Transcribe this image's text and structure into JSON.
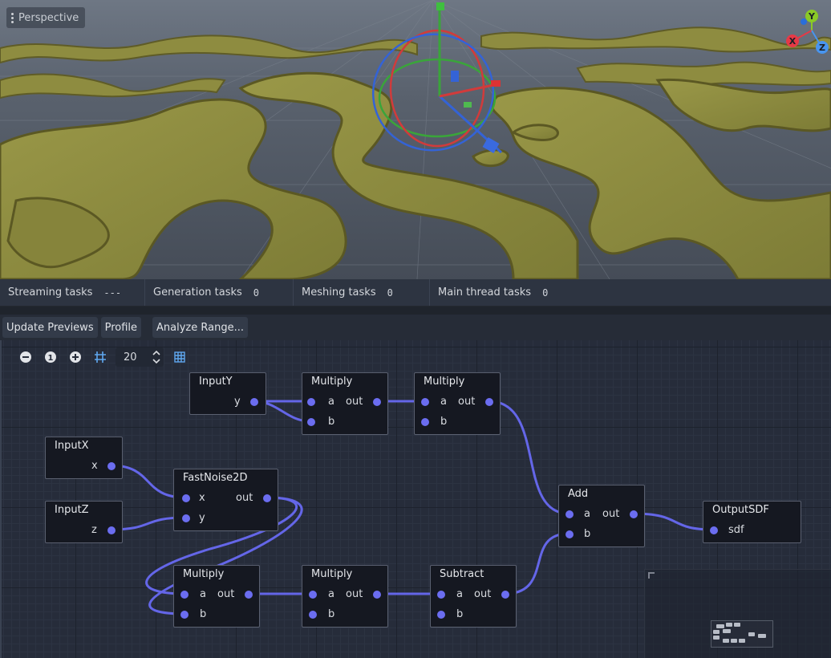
{
  "viewport": {
    "view_label": "Perspective",
    "gizmo_axes": {
      "y": "Y",
      "x": "X",
      "z": "Z"
    },
    "colors": {
      "sky": "#5d6672",
      "terrain": "#8a8a3d",
      "terrain_edge": "#5d5a25"
    }
  },
  "status": [
    {
      "label": "Streaming tasks",
      "value": "---"
    },
    {
      "label": "Generation tasks",
      "value": "0"
    },
    {
      "label": "Meshing tasks",
      "value": "0"
    },
    {
      "label": "Main thread tasks",
      "value": "0"
    }
  ],
  "toolbar": {
    "update_previews": "Update Previews",
    "profile": "Profile",
    "analyze_range": "Analyze Range..."
  },
  "graph": {
    "zoom": {
      "zoom_out_icon": "minus-circle-icon",
      "reset_icon": "one-circle-icon",
      "zoom_in_icon": "plus-circle-icon",
      "snap_icon": "snap-grid-icon",
      "snap_value": "20",
      "minimap_icon": "minimap-grid-icon"
    },
    "port_color": "#6b6df0",
    "nodes": {
      "inputy": {
        "title": "InputY",
        "outputs": [
          "y"
        ]
      },
      "mul1": {
        "title": "Multiply",
        "inputs": [
          "a",
          "b"
        ],
        "outputs": [
          "out"
        ]
      },
      "mul2": {
        "title": "Multiply",
        "inputs": [
          "a",
          "b"
        ],
        "outputs": [
          "out"
        ]
      },
      "inputx": {
        "title": "InputX",
        "outputs": [
          "x"
        ]
      },
      "inputz": {
        "title": "InputZ",
        "outputs": [
          "z"
        ]
      },
      "noise": {
        "title": "FastNoise2D",
        "inputs": [
          "x",
          "y"
        ],
        "outputs": [
          "out"
        ]
      },
      "add": {
        "title": "Add",
        "inputs": [
          "a",
          "b"
        ],
        "outputs": [
          "out"
        ]
      },
      "output": {
        "title": "OutputSDF",
        "inputs": [
          "sdf"
        ]
      },
      "mul3": {
        "title": "Multiply",
        "inputs": [
          "a",
          "b"
        ],
        "outputs": [
          "out"
        ]
      },
      "mul4": {
        "title": "Multiply",
        "inputs": [
          "a",
          "b"
        ],
        "outputs": [
          "out"
        ]
      },
      "sub": {
        "title": "Subtract",
        "inputs": [
          "a",
          "b"
        ],
        "outputs": [
          "out"
        ]
      }
    }
  }
}
